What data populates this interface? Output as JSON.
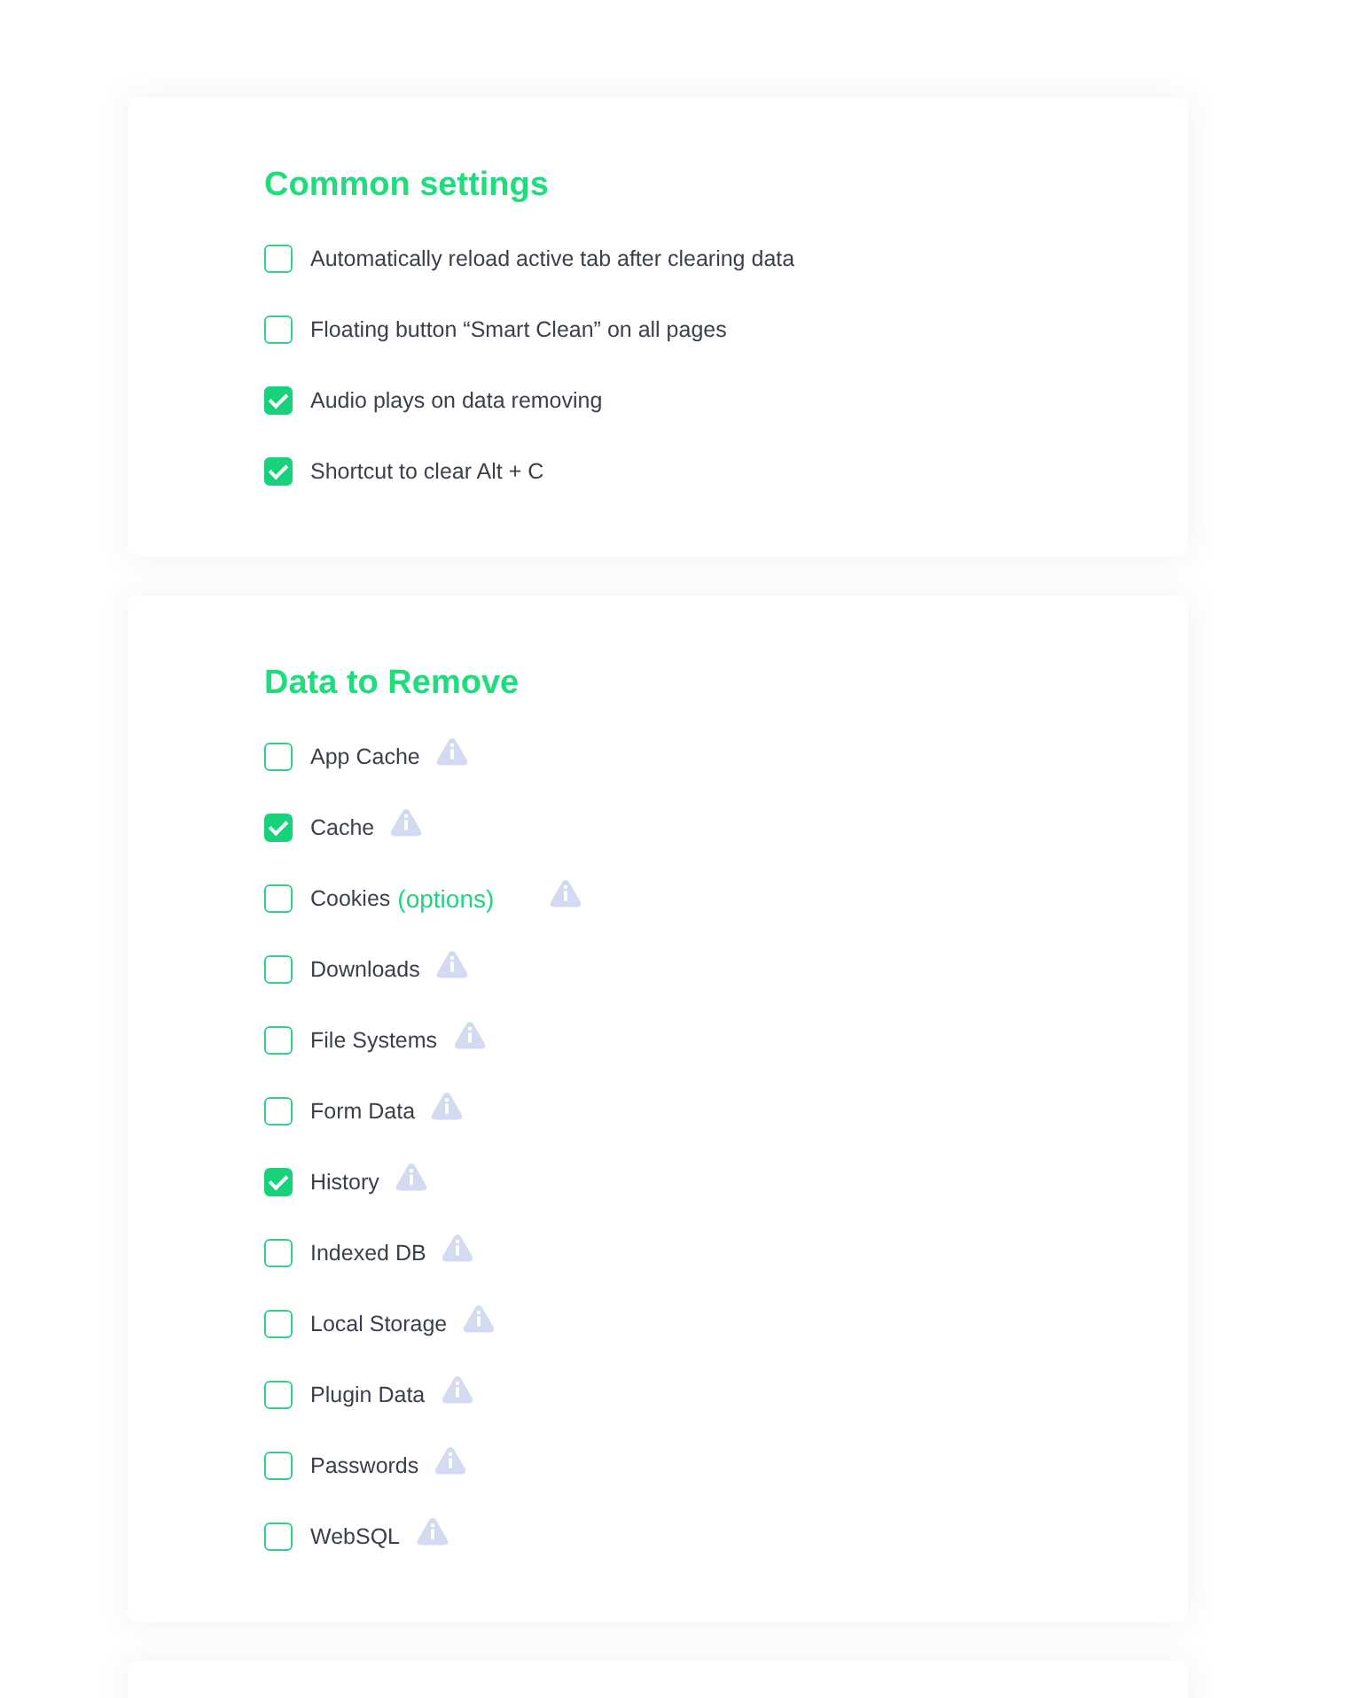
{
  "sections": [
    {
      "title": "Common settings",
      "items": [
        {
          "label": "Automatically reload active tab after clearing data",
          "checked": false,
          "info": false
        },
        {
          "label": "Floating button “Smart Clean” on all pages",
          "checked": false,
          "info": false
        },
        {
          "label": "Audio plays on data removing",
          "checked": true,
          "info": false
        },
        {
          "label": "Shortcut to clear Alt + C",
          "checked": true,
          "info": false
        }
      ]
    },
    {
      "title": "Data to Remove",
      "items": [
        {
          "label": "App Cache",
          "checked": false,
          "info": true
        },
        {
          "label": "Cache",
          "checked": true,
          "info": true
        },
        {
          "label": "Cookies",
          "link": "(options)",
          "checked": false,
          "info": true
        },
        {
          "label": "Downloads",
          "checked": false,
          "info": true
        },
        {
          "label": "File Systems",
          "checked": false,
          "info": true
        },
        {
          "label": "Form Data",
          "checked": false,
          "info": true
        },
        {
          "label": "History",
          "checked": true,
          "info": true
        },
        {
          "label": "Indexed DB",
          "checked": false,
          "info": true
        },
        {
          "label": "Local Storage",
          "checked": false,
          "info": true
        },
        {
          "label": "Plugin Data",
          "checked": false,
          "info": true
        },
        {
          "label": "Passwords",
          "checked": false,
          "info": true
        },
        {
          "label": "WebSQL",
          "checked": false,
          "info": true
        }
      ]
    }
  ]
}
